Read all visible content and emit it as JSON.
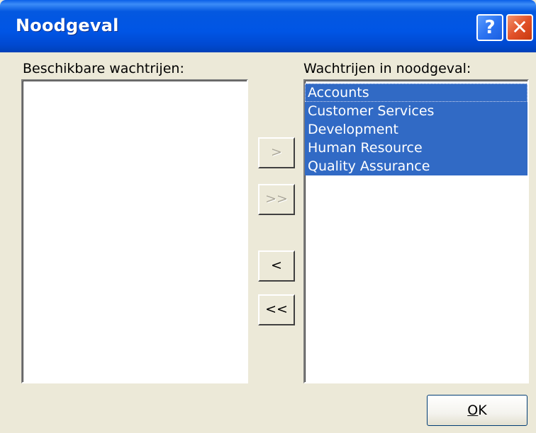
{
  "window": {
    "title": "Noodgeval",
    "help_label": "?",
    "close_label": "✕"
  },
  "left_panel": {
    "label": "Beschikbare wachtrijen:",
    "items": []
  },
  "right_panel": {
    "label": "Wachtrijen in noodgeval:",
    "items": [
      "Accounts",
      "Customer Services",
      "Development",
      "Human Resource",
      "Quality Assurance"
    ],
    "selected": [
      "Accounts",
      "Customer Services",
      "Development",
      "Human Resource",
      "Quality Assurance"
    ]
  },
  "move_buttons": {
    "add_label": ">",
    "add_all_label": ">>",
    "remove_label": "<",
    "remove_all_label": "<<",
    "add_enabled": false,
    "add_all_enabled": false,
    "remove_enabled": true,
    "remove_all_enabled": true
  },
  "ok_button": {
    "label_mnemonic": "O",
    "label_rest": "K"
  },
  "colors": {
    "titlebar": "#0055e5",
    "selection": "#316ac5",
    "dialog_bg": "#ece9d8"
  }
}
